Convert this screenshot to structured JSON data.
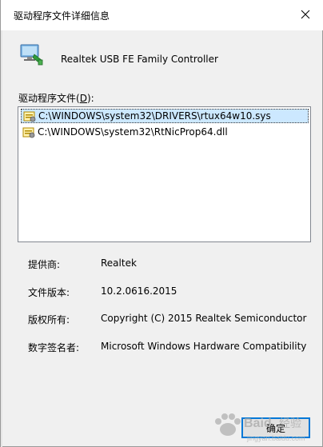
{
  "window": {
    "title": "驱动程序文件详细信息",
    "close_icon": "close-icon"
  },
  "device": {
    "name": "Realtek USB FE Family Controller",
    "icon": "network-adapter-icon"
  },
  "files": {
    "label_prefix": "驱动程序文件(",
    "label_accel": "D",
    "label_suffix": "):",
    "items": [
      {
        "path": "C:\\WINDOWS\\system32\\DRIVERS\\rtux64w10.sys",
        "selected": true
      },
      {
        "path": "C:\\WINDOWS\\system32\\RtNicProp64.dll",
        "selected": false
      }
    ]
  },
  "details": {
    "provider_label": "提供商:",
    "provider_value": "Realtek",
    "version_label": "文件版本:",
    "version_value": "10.2.0616.2015",
    "copyright_label": "版权所有:",
    "copyright_value": "Copyright (C) 2015 Realtek Semiconductor",
    "signer_label": "数字签名者:",
    "signer_value": "Microsoft Windows Hardware Compatibility"
  },
  "buttons": {
    "ok_label": "确定"
  },
  "colors": {
    "selection": "#cce8ff",
    "accent": "#0078d7"
  }
}
